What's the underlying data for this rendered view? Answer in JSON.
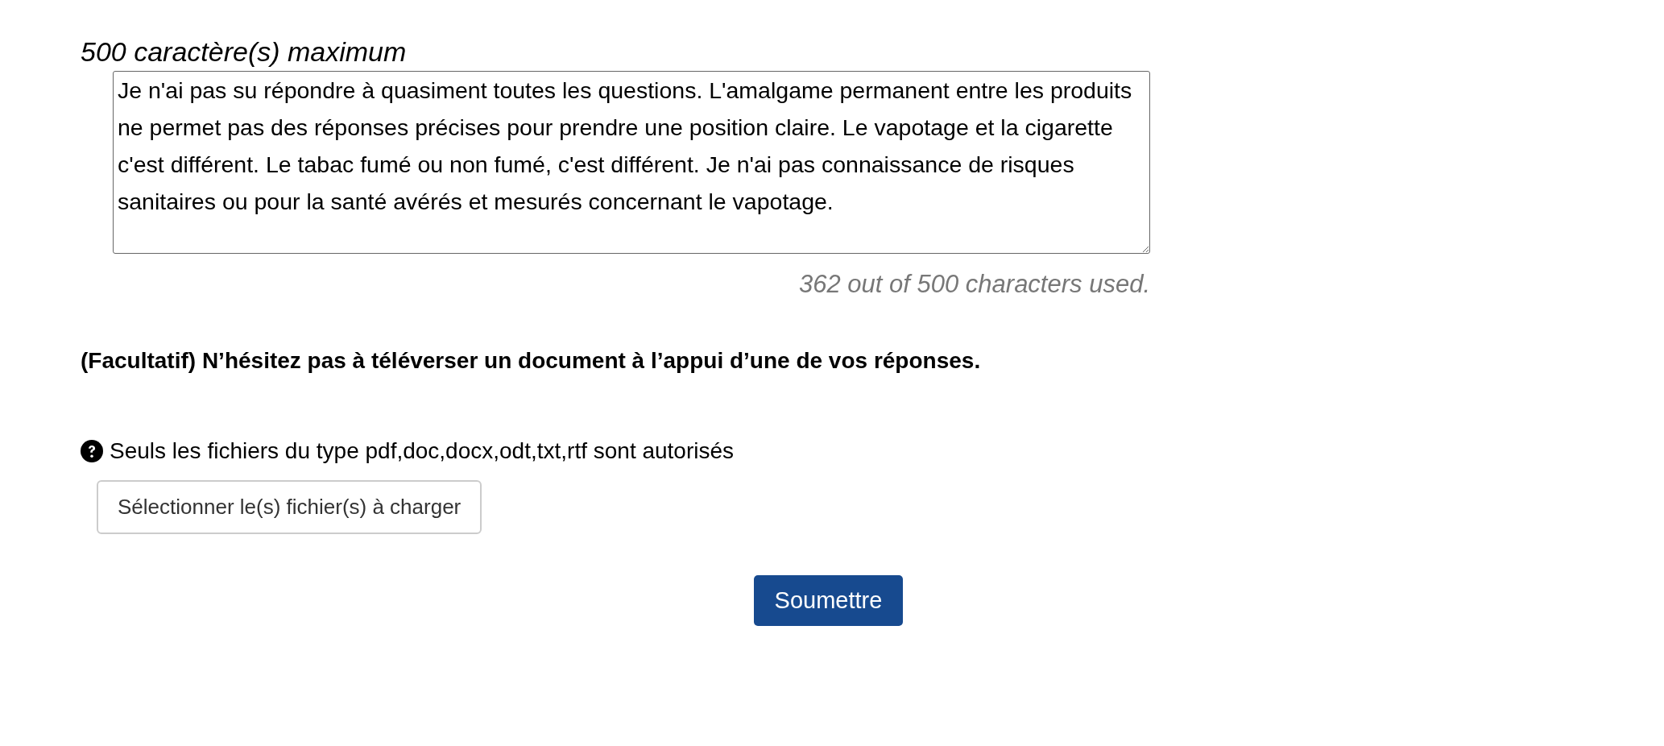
{
  "answer": {
    "limit_label": "500 caractère(s) maximum",
    "value": "Je n'ai pas su répondre à quasiment toutes les questions. L'amalgame permanent entre les produits ne permet pas des réponses précises pour prendre une position claire. Le vapotage et la cigarette c'est différent. Le tabac fumé ou non fumé, c'est différent. Je n'ai pas connaissance de risques sanitaires ou pour la santé avérés et mesurés concernant le vapotage.",
    "counter": "362 out of 500 characters used."
  },
  "upload": {
    "label": "(Facultatif) N’hésitez pas à téléverser un document à l’appui d’une de vos réponses.",
    "help": "Seuls les fichiers du type pdf,doc,docx,odt,txt,rtf sont autorisés",
    "button": "Sélectionner le(s) fichier(s) à charger"
  },
  "submit": "Soumettre"
}
